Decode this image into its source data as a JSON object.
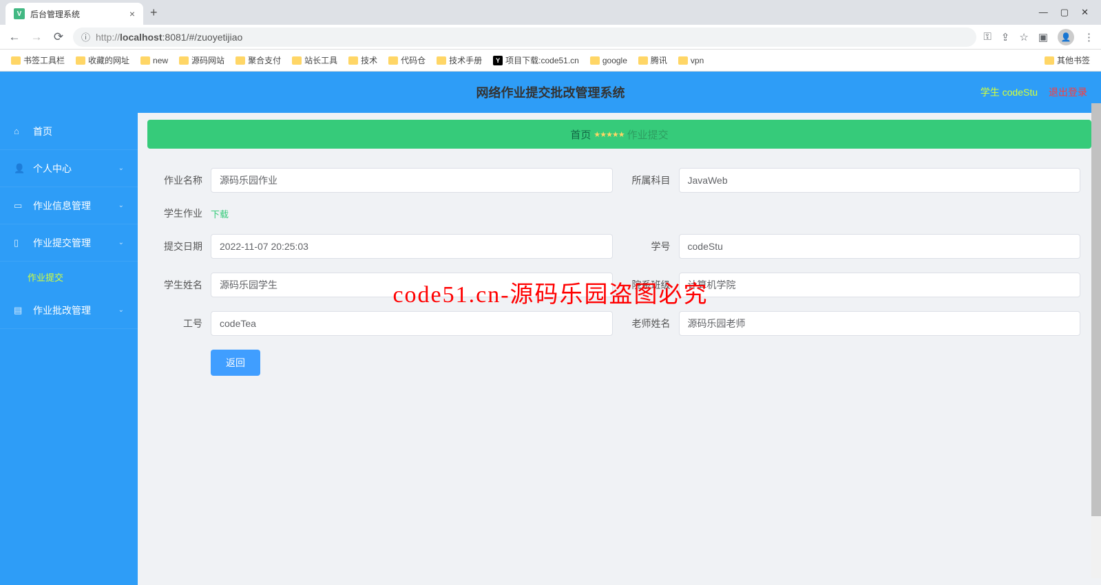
{
  "browser": {
    "tab_title": "后台管理系统",
    "url_display": "http://localhost:8081/#/zuoyetijiao",
    "url_host": "localhost",
    "url_port": ":8081",
    "url_path": "/#/zuoyetijiao"
  },
  "bookmarks": [
    {
      "label": "书签工具栏"
    },
    {
      "label": "收藏的网址"
    },
    {
      "label": "new"
    },
    {
      "label": "源码网站"
    },
    {
      "label": "聚合支付"
    },
    {
      "label": "站长工具"
    },
    {
      "label": "技术"
    },
    {
      "label": "代码仓"
    },
    {
      "label": "技术手册"
    },
    {
      "label": "项目下载:code51.cn",
      "icon": "y"
    },
    {
      "label": "google"
    },
    {
      "label": "腾讯"
    },
    {
      "label": "vpn"
    }
  ],
  "bookmark_right": "其他书签",
  "header": {
    "title": "网络作业提交批改管理系统",
    "role_user": "学生 codeStu",
    "logout": "退出登录"
  },
  "sidebar": [
    {
      "icon": "⌂",
      "label": "首页",
      "expandable": false
    },
    {
      "icon": "👤",
      "label": "个人中心",
      "expandable": true
    },
    {
      "icon": "▭",
      "label": "作业信息管理",
      "expandable": true
    },
    {
      "icon": "▯",
      "label": "作业提交管理",
      "expandable": true,
      "children": [
        {
          "label": "作业提交"
        }
      ]
    },
    {
      "icon": "▤",
      "label": "作业批改管理",
      "expandable": true
    }
  ],
  "banner": {
    "home": "首页",
    "stars": "★★★★★",
    "current": "作业提交"
  },
  "form": {
    "assignment_name": {
      "label": "作业名称",
      "value": "源码乐园作业"
    },
    "subject": {
      "label": "所属科目",
      "value": "JavaWeb"
    },
    "student_work": {
      "label": "学生作业",
      "link": "下载"
    },
    "submit_date": {
      "label": "提交日期",
      "value": "2022-11-07 20:25:03"
    },
    "student_id": {
      "label": "学号",
      "value": "codeStu"
    },
    "student_name": {
      "label": "学生姓名",
      "value": "源码乐园学生"
    },
    "dept_class": {
      "label": "院系班级",
      "value": "计算机学院"
    },
    "teacher_id": {
      "label": "工号",
      "value": "codeTea"
    },
    "teacher_name": {
      "label": "老师姓名",
      "value": "源码乐园老师"
    },
    "return_btn": "返回"
  },
  "watermark": "code51.cn-源码乐园盗图必究"
}
